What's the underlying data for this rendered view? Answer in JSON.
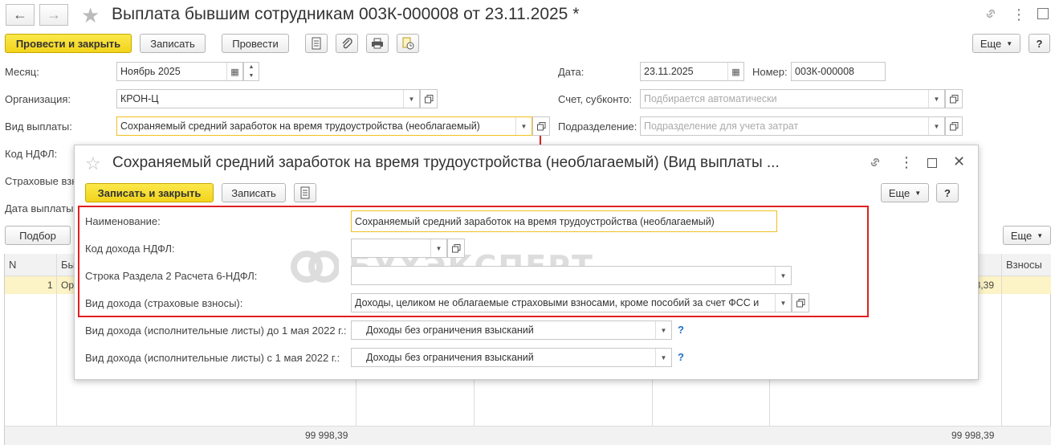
{
  "window": {
    "title": "Выплата бывшим сотрудникам 003К-000008 от 23.11.2025 *"
  },
  "toolbar": {
    "post_close": "Провести и закрыть",
    "save": "Записать",
    "post": "Провести",
    "more": "Еще",
    "help": "?"
  },
  "form": {
    "month_label": "Месяц:",
    "month_value": "Ноябрь 2025",
    "org_label": "Организация:",
    "org_value": "КРОН-Ц",
    "paytype_label": "Вид выплаты:",
    "paytype_value": "Сохраняемый средний заработок на время трудоустройства (необлагаемый)",
    "ndfl_label": "Код НДФЛ:",
    "insurance_label": "Страховые взн",
    "paydate_label": "Дата выплаты",
    "date_label": "Дата:",
    "date_value": "23.11.2025",
    "number_label": "Номер:",
    "number_value": "003К-000008",
    "account_label": "Счет, субконто:",
    "account_placeholder": "Подбирается автоматически",
    "dept_label": "Подразделение:",
    "dept_placeholder": "Подразделение для учета затрат"
  },
  "grid": {
    "pick_button": "Подбор",
    "more": "Еще",
    "col_n": "N",
    "col_b": "Бы",
    "col_contrib": "Взносы",
    "row_n": "1",
    "row_b": "Ор",
    "row_amount": "98,39",
    "total_left": "99 998,39",
    "total_right": "99 998,39"
  },
  "dialog": {
    "title": "Сохраняемый средний заработок на время трудоустройства (необлагаемый) (Вид выплаты ...",
    "save_close": "Записать и закрыть",
    "save": "Записать",
    "more": "Еще",
    "help": "?",
    "name_label": "Наименование:",
    "name_value": "Сохраняемый средний заработок на время трудоустройства (необлагаемый)",
    "ndfl_code_label": "Код дохода НДФЛ:",
    "ndfl_code_value": "",
    "section2_label": "Строка Раздела 2 Расчета 6-НДФЛ:",
    "section2_value": "",
    "income_ins_label": "Вид дохода (страховые взносы):",
    "income_ins_value": "Доходы, целиком не облагаемые страховыми взносами, кроме пособий за счет ФСС и",
    "exec_before_label": "Вид дохода (исполнительные листы) до 1 мая 2022 г.:",
    "exec_before_value": "Доходы без ограничения взысканий",
    "exec_after_label": "Вид дохода (исполнительные листы) с 1 мая 2022 г.:",
    "exec_after_value": "Доходы без ограничения взысканий",
    "q": "?"
  },
  "watermark": {
    "text": "БУХЭКСПЕРТ"
  },
  "colors": {
    "accent_yellow": "#f5d829",
    "highlight_red": "#e02020",
    "link_blue": "#1f6fc5"
  }
}
